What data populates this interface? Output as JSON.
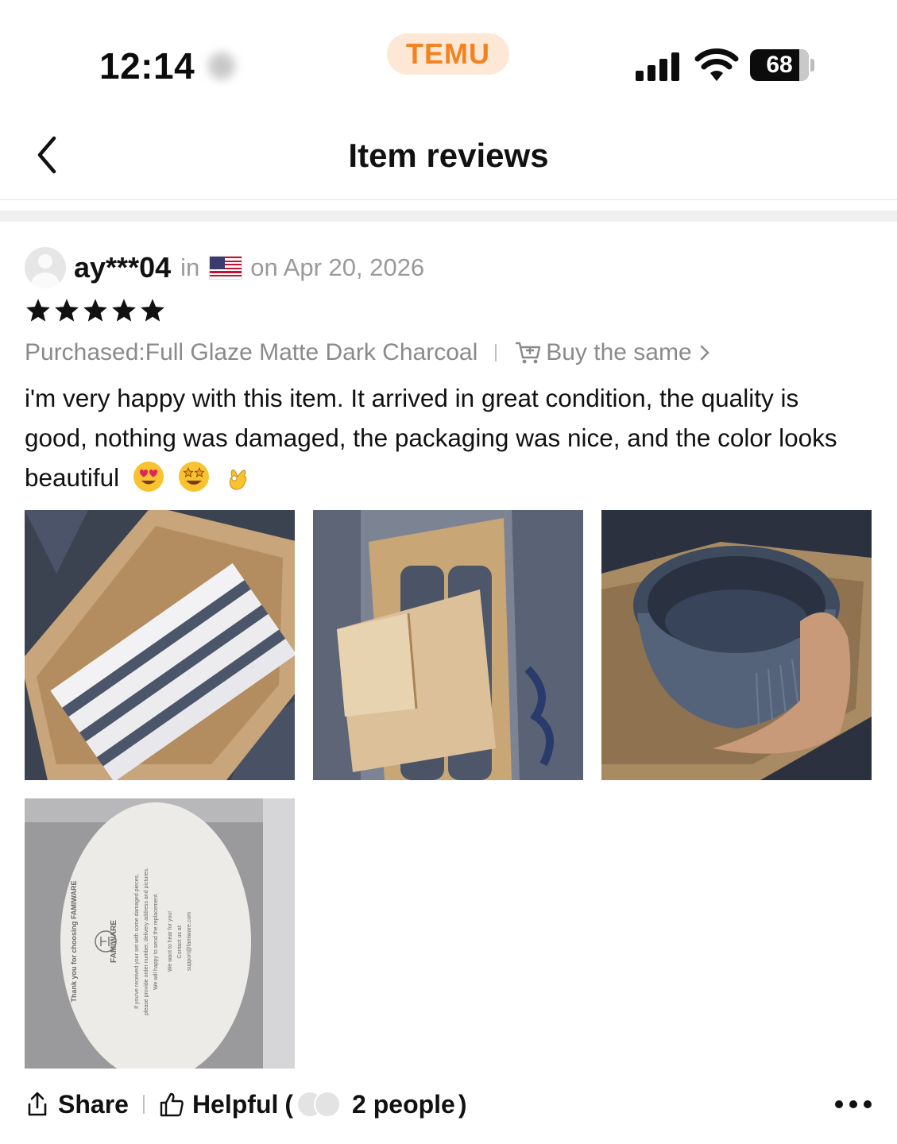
{
  "status_bar": {
    "time": "12:14",
    "app_name": "TEMU",
    "battery_level": "68"
  },
  "header": {
    "title": "Item reviews"
  },
  "review": {
    "username": "ay***04",
    "in_word": "in",
    "country": "US",
    "date": "on Apr 20, 2026",
    "rating": 5,
    "purchased": "Purchased:Full Glaze Matte Dark Charcoal",
    "buy_same_label": "Buy the same",
    "text": "i'm very happy with this item. It arrived in great condition, the quality is good, nothing was damaged, the packaging was nice, and the color looks beautiful",
    "emojis": [
      "heart-eyes-emoji",
      "star-struck-emoji",
      "ok-hand-emoji"
    ],
    "photos": [
      "plates-in-box-photo",
      "bowls-in-box-photo",
      "bowl-in-hand-photo",
      "thank-you-card-photo"
    ],
    "card_text": {
      "line1": "Thank you for choosing FAMIWARE",
      "brand": "FAMIWARE",
      "line2": "If you've received your set with some damaged pieces,",
      "line3": "please provide order number, delivery address and pictures.",
      "line4": "We will happy to send the replacement.",
      "line5": "We want to hear for you!",
      "line6": "Contact us at:",
      "line7": "support@famiware.com"
    }
  },
  "footer": {
    "share_label": "Share",
    "helpful_label": "Helpful",
    "open_paren": "(",
    "helpful_count": "2 people",
    "close_paren": ")"
  },
  "colors": {
    "brand_orange": "#f58220",
    "brand_pill_bg": "#fde8d6",
    "muted_text": "#8a8a8a",
    "separator": "#f0f0f0"
  }
}
